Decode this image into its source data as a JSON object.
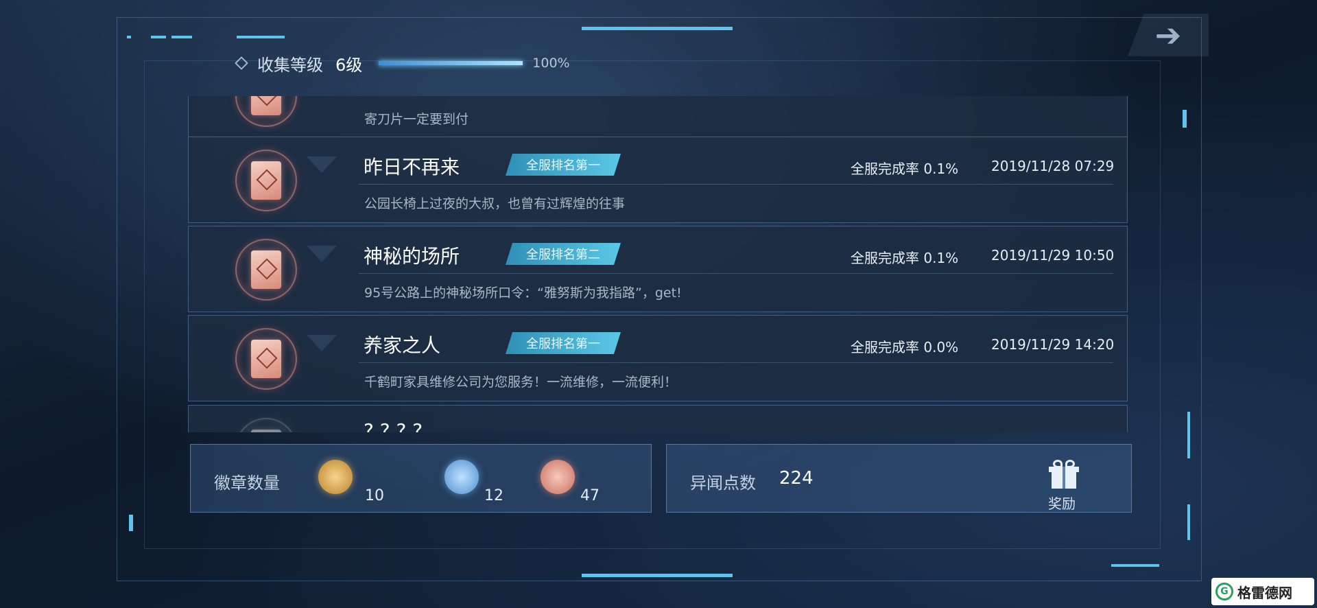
{
  "header": {
    "label": "收集等级",
    "level": "6级",
    "progress": 1.0,
    "progress_text": "100%"
  },
  "next_icon": "arrow-right-icon",
  "list": {
    "partial_top_desc": "寄刀片一定要到付",
    "items": [
      {
        "title": "昨日不再来",
        "rank": "全服排名第一",
        "rate": "全服完成率 0.1%",
        "date": "2019/11/28 07:29",
        "desc": "公园长椅上过夜的大叔，也曾有过辉煌的往事"
      },
      {
        "title": "神秘的场所",
        "rank": "全服排名第二",
        "rate": "全服完成率 0.1%",
        "date": "2019/11/29 10:50",
        "desc": "95号公路上的神秘场所口令：“雅努斯为我指路”，get!"
      },
      {
        "title": "养家之人",
        "rank": "全服排名第一",
        "rate": "全服完成率 0.0%",
        "date": "2019/11/29 14:20",
        "desc": "千鹤町家具维修公司为您服务！一流维修，一流便利！"
      }
    ],
    "partial_bottom_title": "? ? ? ?"
  },
  "badges": {
    "label": "徽章数量",
    "gold_count": "10",
    "blue_count": "12",
    "red_count": "47"
  },
  "points": {
    "label": "异闻点数",
    "value": "224",
    "reward_label": "奖励",
    "reward_icon": "gift-icon"
  },
  "watermark": {
    "text": "格雷德网",
    "logo_letter": "G"
  },
  "colors": {
    "accent": "#5fc3ee",
    "rank_tag": "#3fa9cf",
    "badge_glow": "#e9968a"
  }
}
